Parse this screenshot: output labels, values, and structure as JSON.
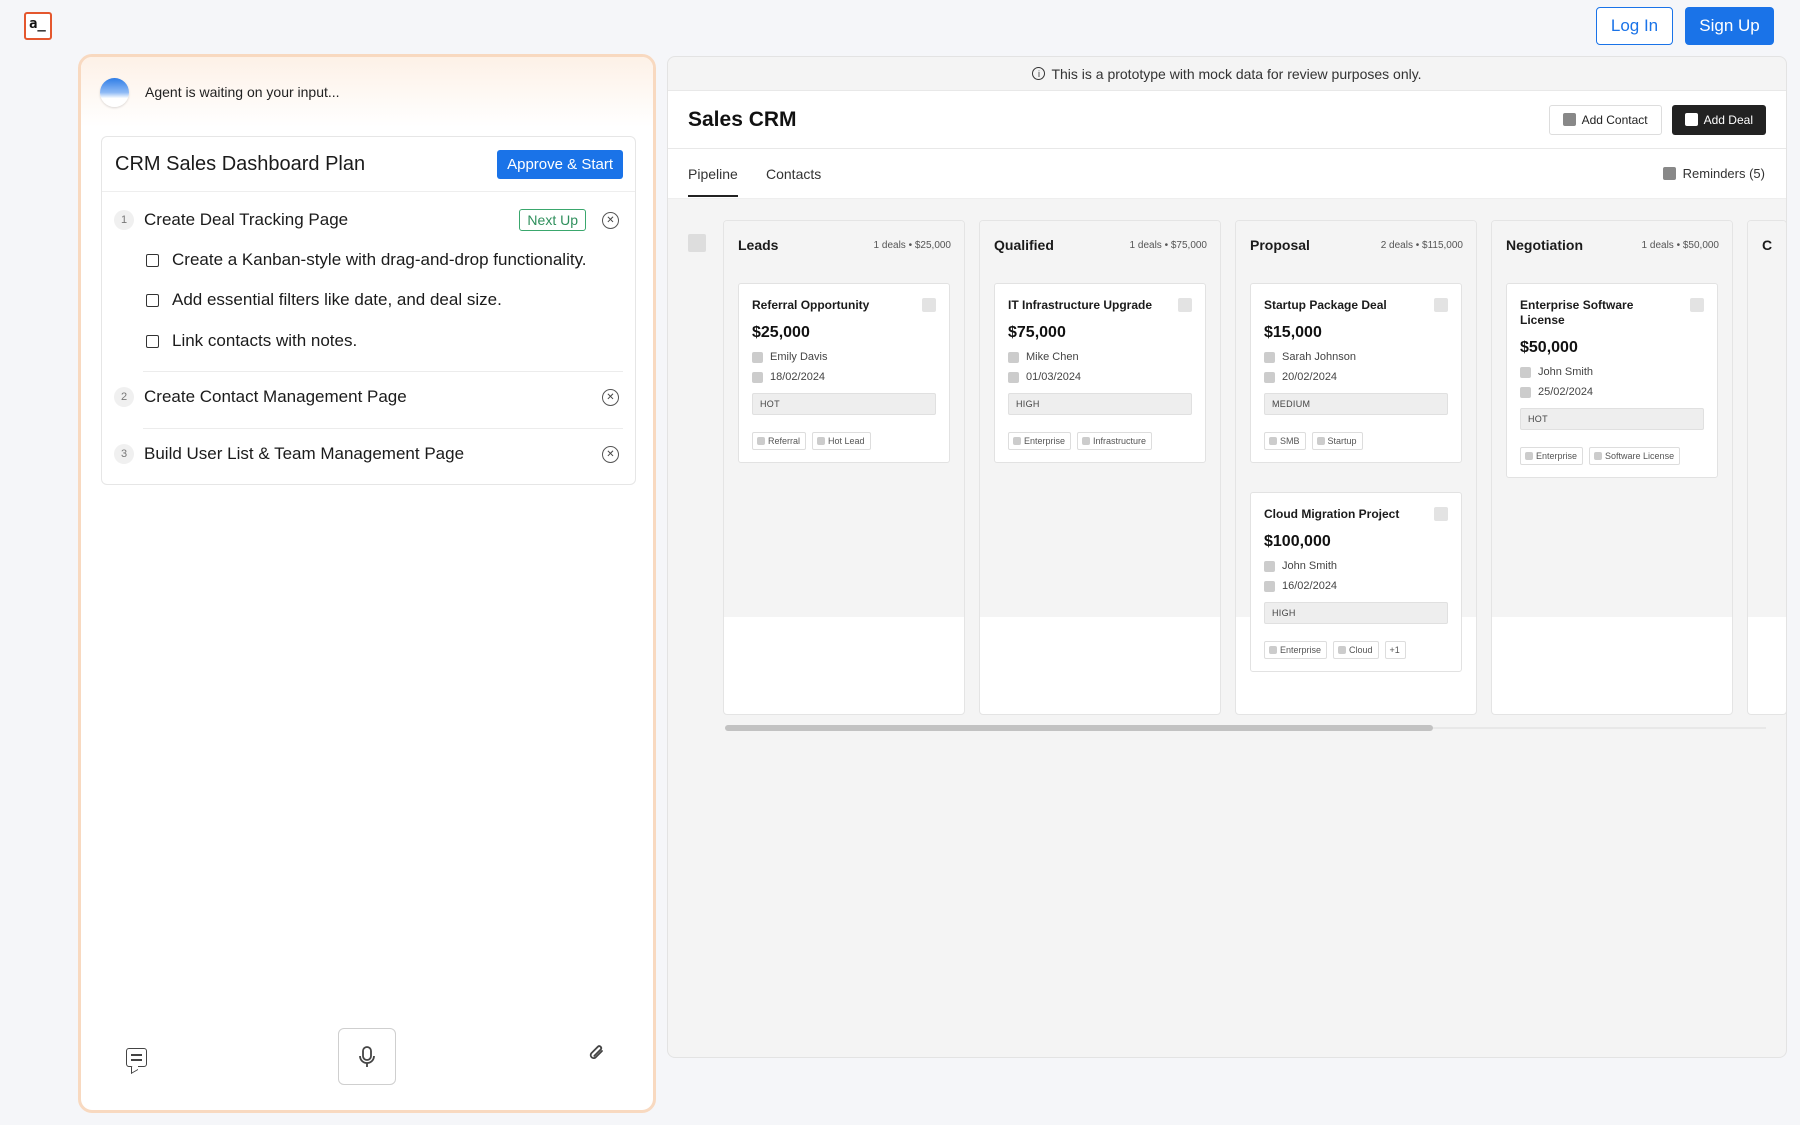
{
  "app": {
    "logo_text": "a_"
  },
  "auth": {
    "login": "Log In",
    "signup": "Sign Up"
  },
  "agent": {
    "status": "Agent is waiting on your input...",
    "plan": {
      "title": "CRM Sales Dashboard Plan",
      "approve_label": "Approve & Start",
      "steps": [
        {
          "num": "1",
          "title": "Create Deal Tracking Page",
          "badge": "Next Up",
          "tasks": [
            "Create a Kanban-style with drag-and-drop functionality.",
            "Add essential filters like date, and deal size.",
            "Link contacts with notes."
          ]
        },
        {
          "num": "2",
          "title": "Create Contact Management Page"
        },
        {
          "num": "3",
          "title": "Build User List & Team Management Page"
        }
      ]
    },
    "composer": {
      "chat_icon": "chat-icon",
      "mic_icon": "microphone-icon",
      "attach_icon": "paperclip-icon"
    }
  },
  "crm": {
    "notice": "This is a prototype with mock data for review purposes only.",
    "title": "Sales CRM",
    "add_contact": "Add Contact",
    "add_deal": "Add Deal",
    "tabs": [
      "Pipeline",
      "Contacts"
    ],
    "active_tab": "Pipeline",
    "reminders": "Reminders (5)",
    "columns": [
      {
        "name": "Leads",
        "meta": "1 deals • $25,000",
        "cards": [
          {
            "name": "Referral Opportunity",
            "amount": "$25,000",
            "contact": "Emily Davis",
            "date": "18/02/2024",
            "priority": "HOT",
            "tags": [
              "Referral",
              "Hot Lead"
            ]
          }
        ]
      },
      {
        "name": "Qualified",
        "meta": "1 deals • $75,000",
        "cards": [
          {
            "name": "IT Infrastructure Upgrade",
            "amount": "$75,000",
            "contact": "Mike Chen",
            "date": "01/03/2024",
            "priority": "HIGH",
            "tags": [
              "Enterprise",
              "Infrastructure"
            ]
          }
        ]
      },
      {
        "name": "Proposal",
        "meta": "2 deals • $115,000",
        "cards": [
          {
            "name": "Startup Package Deal",
            "amount": "$15,000",
            "contact": "Sarah Johnson",
            "date": "20/02/2024",
            "priority": "MEDIUM",
            "tags": [
              "SMB",
              "Startup"
            ]
          },
          {
            "name": "Cloud Migration Project",
            "amount": "$100,000",
            "contact": "John Smith",
            "date": "16/02/2024",
            "priority": "HIGH",
            "tags": [
              "Enterprise",
              "Cloud",
              "+1"
            ]
          }
        ]
      },
      {
        "name": "Negotiation",
        "meta": "1 deals • $50,000",
        "cards": [
          {
            "name": "Enterprise Software License",
            "amount": "$50,000",
            "contact": "John Smith",
            "date": "25/02/2024",
            "priority": "HOT",
            "tags": [
              "Enterprise",
              "Software License"
            ]
          }
        ]
      },
      {
        "name": "C",
        "meta": "",
        "cards": []
      }
    ]
  },
  "colors": {
    "accent": "#1a73e8",
    "agent_border": "#f8d9c0",
    "next_up": "#2f8f5c"
  }
}
